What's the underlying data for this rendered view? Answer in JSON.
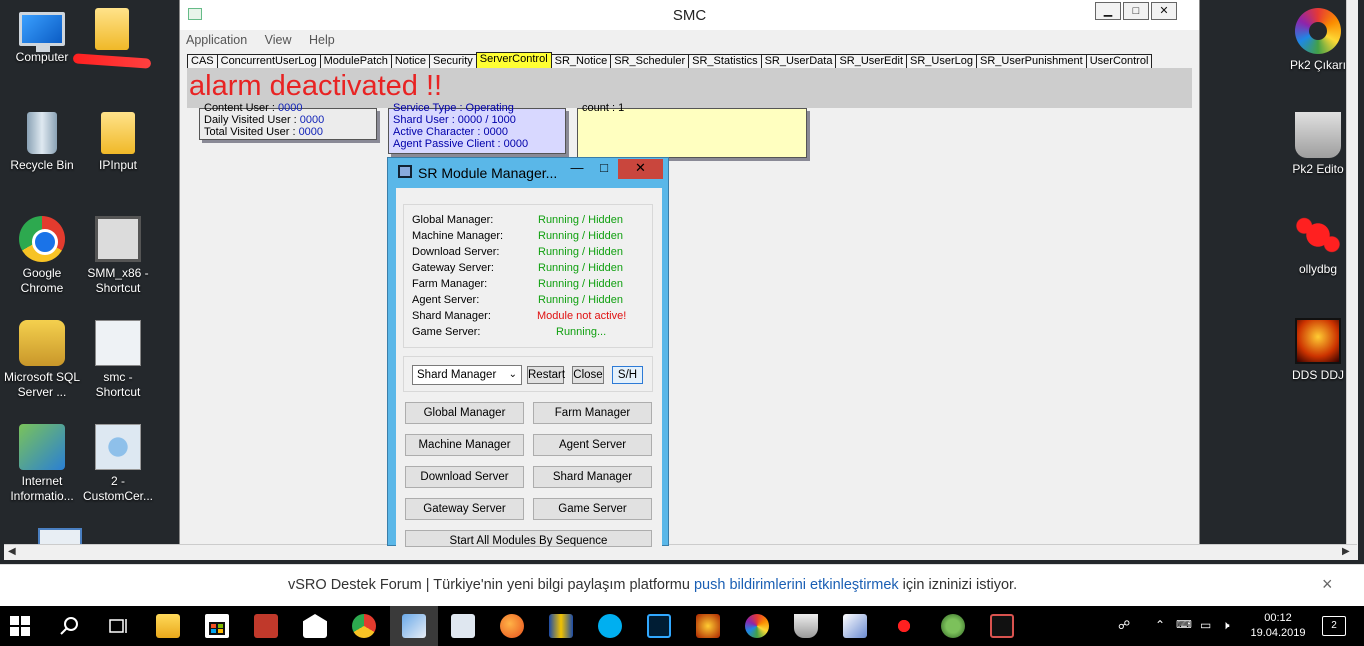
{
  "desktop": {
    "icons_left": [
      {
        "label": "Computer"
      },
      {
        "label": "Recycle Bin"
      },
      {
        "label": "IPInput"
      },
      {
        "label": "Google Chrome"
      },
      {
        "label": "SMM_x86 - Shortcut"
      },
      {
        "label": "Microsoft SQL Server ..."
      },
      {
        "label": "smc - Shortcut"
      },
      {
        "label": "Internet Informatio..."
      },
      {
        "label": "2 - CustomCer..."
      }
    ],
    "icons_right": [
      {
        "label": "Pk2 Çıkarı"
      },
      {
        "label": "Pk2 Edito"
      },
      {
        "label": "ollydbg"
      },
      {
        "label": "DDS DDJ"
      }
    ]
  },
  "smc": {
    "title": "SMC",
    "controls": {
      "minimize": "▁",
      "maximize": "□",
      "close": "✕"
    },
    "menu": [
      "Application",
      "View",
      "Help"
    ],
    "tabs": [
      "CAS",
      "ConcurrentUserLog",
      "ModulePatch",
      "Notice",
      "Security",
      "ServerControl",
      "SR_Notice",
      "SR_Scheduler",
      "SR_Statistics",
      "SR_UserData",
      "SR_UserEdit",
      "SR_UserLog",
      "SR_UserPunishment",
      "UserControl"
    ],
    "active_tab": "ServerControl",
    "alarm_text": "alarm deactivated !!",
    "panel1": {
      "rows": [
        {
          "label": "Content User : ",
          "value": "0000"
        },
        {
          "label": "Daily Visited User : ",
          "value": "0000"
        },
        {
          "label": "Total Visited User : ",
          "value": "0000"
        }
      ]
    },
    "panel2": {
      "rows": [
        "Service Type : Operating",
        "Shard User : 0000 / 1000",
        "Active Character : 0000",
        "Agent Passive Client : 0000"
      ]
    },
    "panel3": {
      "text": "count : 1"
    }
  },
  "sr_module_manager": {
    "title": "SR Module Manager...",
    "controls": {
      "minimize": "—",
      "maximize": "□",
      "close": "✕"
    },
    "status": [
      {
        "label": "Global Manager:",
        "state": "Running / Hidden",
        "ok": true
      },
      {
        "label": "Machine Manager:",
        "state": "Running / Hidden",
        "ok": true
      },
      {
        "label": "Download Server:",
        "state": "Running / Hidden",
        "ok": true
      },
      {
        "label": "Gateway Server:",
        "state": "Running / Hidden",
        "ok": true
      },
      {
        "label": "Farm Manager:",
        "state": "Running / Hidden",
        "ok": true
      },
      {
        "label": "Agent Server:",
        "state": "Running / Hidden",
        "ok": true
      },
      {
        "label": "Shard Manager:",
        "state": "Module not active!",
        "ok": false
      },
      {
        "label": "Game Server:",
        "state": "Running...",
        "ok": true
      }
    ],
    "select_value": "Shard Manager",
    "restart_label": "Restart",
    "close_label": "Close",
    "sh_label": "S/H",
    "buttons": [
      "Global Manager",
      "Farm Manager",
      "Machine Manager",
      "Agent Server",
      "Download Server",
      "Shard Manager",
      "Gateway Server",
      "Game Server"
    ],
    "start_all_label": "Start All Modules By Sequence"
  },
  "notification": {
    "prefix": "vSRO Destek Forum | Türkiye'nin yeni bilgi paylaşım platformu ",
    "link": "push bildirimlerini etkinleştirmek",
    "suffix": " için izninizi istiyor.",
    "close": "×"
  },
  "taskbar": {
    "time": "00:12",
    "date": "19.04.2019",
    "notifications": "2"
  }
}
